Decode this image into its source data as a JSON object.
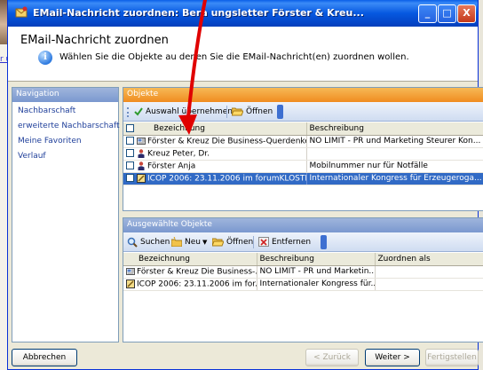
{
  "window": {
    "title": "EMail-Nachricht zuordnen: Bera  ungsletter Förster & Kreu...",
    "controls": {
      "minimize": "_",
      "maximize": "□",
      "close": "X"
    }
  },
  "background": {
    "left_link": "r u e"
  },
  "header": {
    "title": "EMail-Nachricht zuordnen",
    "description": "Wählen Sie die Objekte au  denen Sie die EMail-Nachricht(en) zuordnen wollen."
  },
  "navigation": {
    "heading": "Navigation",
    "items": [
      {
        "label": "Nachbarschaft"
      },
      {
        "label": "erweiterte Nachbarschaft"
      },
      {
        "label": "Meine Favoriten"
      },
      {
        "label": "Verlauf"
      }
    ]
  },
  "objects": {
    "heading": "Objekte",
    "toolbar": {
      "take_selection": "Auswahl übernehmen",
      "open": "Öffnen"
    },
    "columns": [
      "Bezeichnung",
      "Beschreibung"
    ],
    "rows": [
      {
        "icon": "email-icon",
        "name": "Förster & Kreuz Die Business-Querdenker",
        "description": "NO LIMIT - PR und Marketing Steurer Kon...",
        "selected": false
      },
      {
        "icon": "person-icon",
        "name": "Kreuz Peter, Dr.",
        "description": "",
        "selected": false
      },
      {
        "icon": "person-icon",
        "name": "Förster Anja",
        "description": "Mobilnummer nur für Notfälle",
        "selected": false
      },
      {
        "icon": "event-icon",
        "name": "ICOP 2006: 23.11.2006 im forumKLOSTER",
        "description": "Internationaler Kongress für Erzeugeroga...",
        "selected": true
      }
    ]
  },
  "selected_objects": {
    "heading": "Ausgewählte Objekte",
    "toolbar": {
      "search": "Suchen",
      "new": "Neu",
      "open": "Öffnen",
      "remove": "Entfernen"
    },
    "columns": [
      "Bezeichnung",
      "Beschreibung",
      "Zuordnen als"
    ],
    "rows": [
      {
        "icon": "email-icon",
        "name": "Förster & Kreuz Die Business-...",
        "description": "NO LIMIT - PR und Marketin...",
        "assign_as": ""
      },
      {
        "icon": "event-icon",
        "name": "ICOP 2006: 23.11.2006 im for...",
        "description": "Internationaler Kongress für...",
        "assign_as": ""
      }
    ]
  },
  "buttons": {
    "cancel": "Abbrechen",
    "back": "< Zurück",
    "next": "Weiter >",
    "finish": "Fertigstellen"
  },
  "colors": {
    "titlebar": "#0658e0",
    "selection": "#316ac5",
    "objects_header": "#f08c20",
    "annotation_arrow": "#e00000"
  }
}
